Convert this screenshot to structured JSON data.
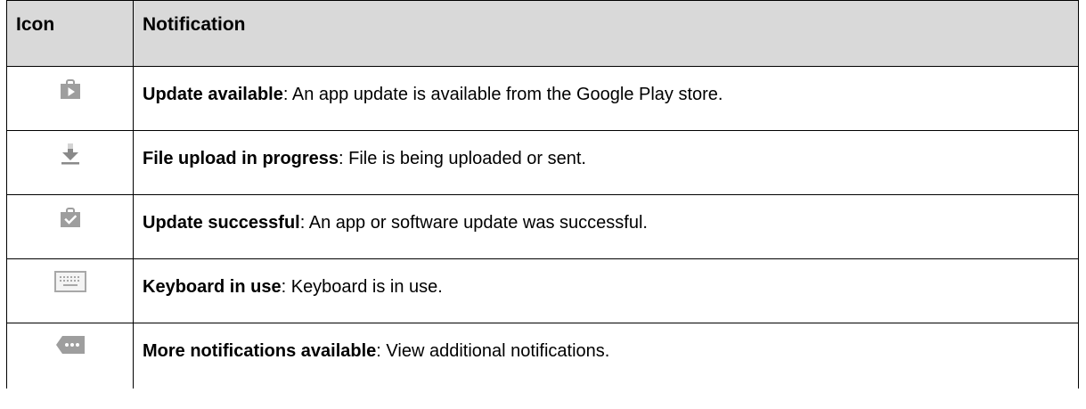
{
  "table": {
    "headers": {
      "icon": "Icon",
      "notification": "Notification"
    },
    "rows": [
      {
        "icon": "play-store-update-icon",
        "title": "Update available",
        "description": ": An app update is available from the Google Play store."
      },
      {
        "icon": "download-arrow-icon",
        "title": "File upload in progress",
        "description": ": File is being uploaded or sent."
      },
      {
        "icon": "update-success-bag-check-icon",
        "title": "Update successful",
        "description": ": An app or software update was successful."
      },
      {
        "icon": "keyboard-icon",
        "title": "Keyboard in use",
        "description": ": Keyboard is in use."
      },
      {
        "icon": "more-notifications-icon",
        "title": "More notifications available",
        "description": ": View additional notifications."
      }
    ]
  },
  "colors": {
    "header_bg": "#d9d9d9",
    "border": "#000000",
    "icon_gray": "#9e9e9e"
  }
}
